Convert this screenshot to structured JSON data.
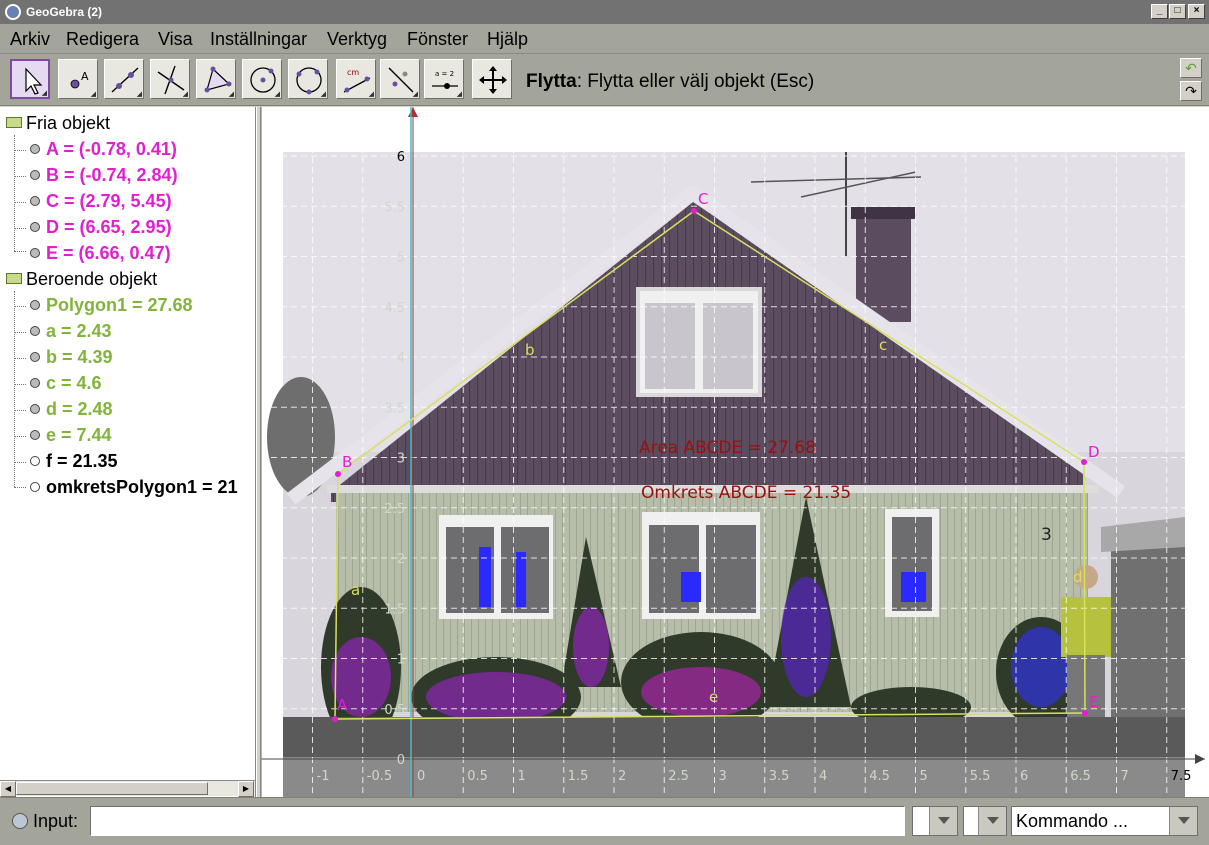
{
  "window": {
    "title": "GeoGebra (2)",
    "minimize_glyph": "_",
    "maximize_glyph": "□",
    "close_glyph": "×"
  },
  "menu": [
    "Arkiv",
    "Redigera",
    "Visa",
    "Inställningar",
    "Verktyg",
    "Fönster",
    "Hjälp"
  ],
  "toolbar": {
    "tools": [
      "move-tool-icon",
      "point-tool-icon",
      "line-tool-icon",
      "perpendicular-tool-icon",
      "polygon-tool-icon",
      "circle-tool-icon",
      "circle-three-points-tool-icon",
      "distance-tool-icon",
      "reflect-tool-icon",
      "slider-tool-icon",
      "move-view-tool-icon"
    ],
    "distance_icon_text": "cm",
    "slider_icon_text": "a = 2",
    "help_tool": "Flytta",
    "help_text": ": Flytta eller välj objekt (Esc)"
  },
  "algebra": {
    "free_header": "Fria objekt",
    "dependent_header": "Beroende objekt",
    "free_items": [
      "A = (-0.78, 0.41)",
      "B = (-0.74, 2.84)",
      "C = (2.79, 5.45)",
      "D = (6.65, 2.95)",
      "E = (6.66, 0.47)"
    ],
    "dependent_items": [
      "Polygon1 = 27.68",
      "a = 2.43",
      "b = 4.39",
      "c = 4.6",
      "d = 2.48",
      "e = 7.44",
      "f = 21.35",
      "omkretsPolygon1 = 21"
    ],
    "colors": {
      "free": "#e020d0",
      "dependent": "#82b43c",
      "hidden": "#000000"
    }
  },
  "graphics": {
    "y_ticks": [
      "6",
      "5.5",
      "5",
      "4.5",
      "4",
      "3.5",
      "3",
      "2.5",
      "2",
      "1.5",
      "1",
      "0.5",
      "0"
    ],
    "x_ticks": [
      "-1",
      "-0.5",
      "0",
      "0.5",
      "1",
      "1.5",
      "2",
      "2.5",
      "3",
      "3.5",
      "4",
      "4.5",
      "5",
      "5.5",
      "6",
      "6.5",
      "7",
      "7.5"
    ],
    "point_labels": [
      "A",
      "B",
      "C",
      "D",
      "E"
    ],
    "segment_labels": [
      "a",
      "b",
      "c",
      "d",
      "e"
    ],
    "area_text": "Area ABCDE = 27.68",
    "perimeter_text": "Omkrets ABCDE = 21.35",
    "house_number": "3",
    "colors": {
      "points": "#e020d0",
      "segments": "#d8e060",
      "text": "#9a1010",
      "axes": "#000000"
    }
  },
  "input": {
    "label": "Input:",
    "value": "",
    "symbol_combo": "",
    "greek_combo": "",
    "command_combo": "Kommando ..."
  }
}
